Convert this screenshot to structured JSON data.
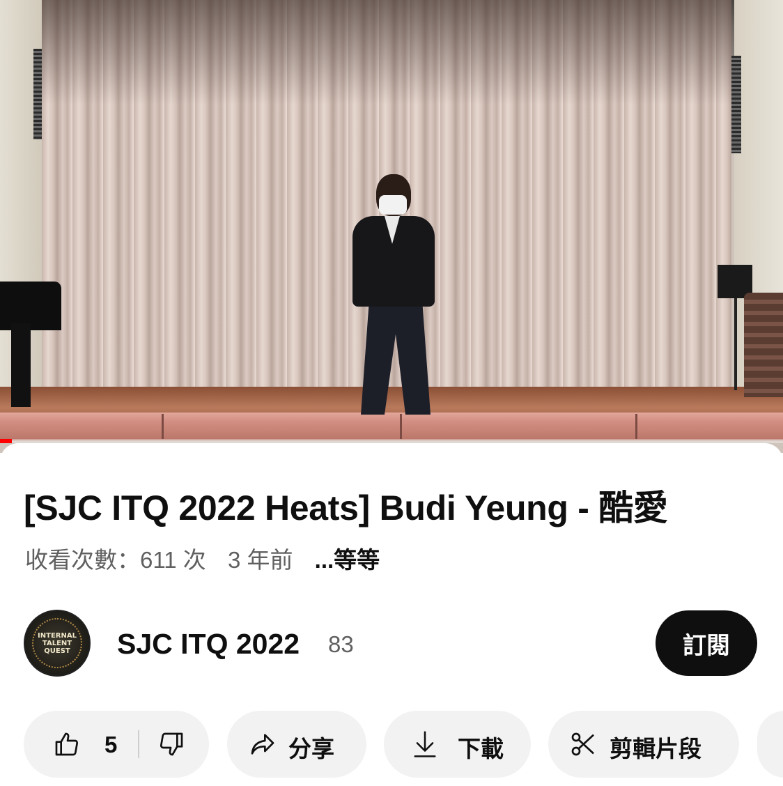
{
  "video": {
    "progress_fraction": 0.015,
    "accent_color": "#ff0000"
  },
  "title": "[SJC ITQ 2022 Heats] Budi Yeung - 酷愛",
  "meta": {
    "views": "收看次數：611 次",
    "age": "3 年前",
    "more": "...等等"
  },
  "channel": {
    "name": "SJC ITQ 2022",
    "subscribers": "83",
    "avatar_text": "INTERNAL TALENT QUEST",
    "subscribe_label": "訂閱"
  },
  "actions": {
    "likes": "5",
    "share_label": "分享",
    "download_label": "下載",
    "clip_label": "剪輯片段"
  },
  "icons": {
    "like": "thumbs-up-icon",
    "dislike": "thumbs-down-icon",
    "share": "share-arrow-icon",
    "download": "download-icon",
    "clip": "scissors-icon"
  }
}
